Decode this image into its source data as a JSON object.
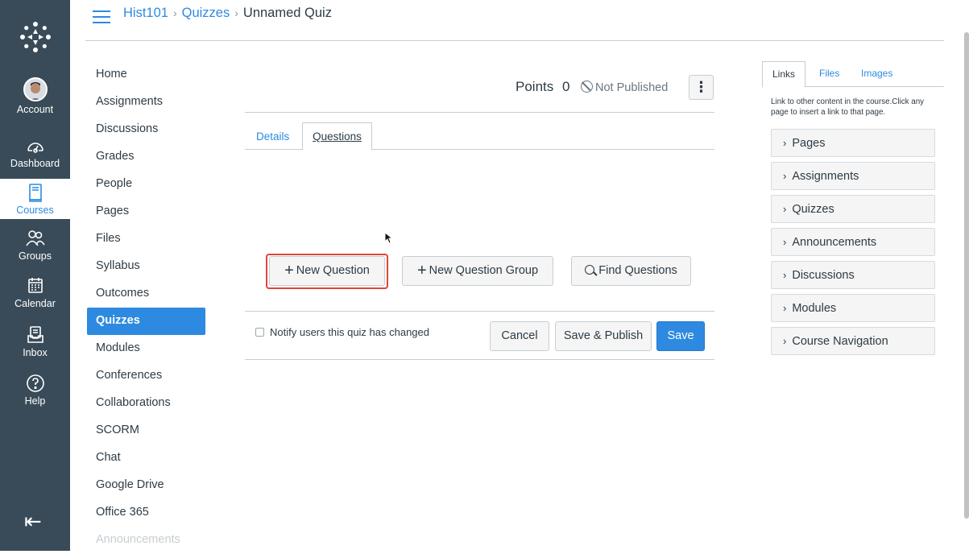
{
  "global_nav": {
    "items": [
      {
        "label": "Account",
        "icon": "avatar"
      },
      {
        "label": "Dashboard",
        "icon": "dashboard-icon"
      },
      {
        "label": "Courses",
        "icon": "courses-icon",
        "active": true
      },
      {
        "label": "Groups",
        "icon": "groups-icon"
      },
      {
        "label": "Calendar",
        "icon": "calendar-icon"
      },
      {
        "label": "Inbox",
        "icon": "inbox-icon"
      },
      {
        "label": "Help",
        "icon": "help-icon"
      }
    ],
    "collapse_glyph": "⇤"
  },
  "breadcrumb": {
    "course": "Hist101",
    "section": "Quizzes",
    "page": "Unnamed Quiz",
    "separator": "›"
  },
  "course_nav": [
    "Home",
    "Assignments",
    "Discussions",
    "Grades",
    "People",
    "Pages",
    "Files",
    "Syllabus",
    "Outcomes",
    "Quizzes",
    "Modules",
    "Conferences",
    "Collaborations",
    "SCORM",
    "Chat",
    "Google Drive",
    "Office 365",
    "Announcements"
  ],
  "course_nav_active": "Quizzes",
  "quiz_header": {
    "points_label": "Points",
    "points_value": "0",
    "status": "Not Published",
    "menu_glyph": "⋮"
  },
  "tabs": {
    "details": "Details",
    "questions": "Questions"
  },
  "actions": {
    "new_question": "New Question",
    "new_question_group": "New Question Group",
    "find_questions": "Find Questions",
    "plus_glyph": "+"
  },
  "footer": {
    "notify_label": "Notify users this quiz has changed",
    "cancel": "Cancel",
    "save_publish": "Save & Publish",
    "save": "Save"
  },
  "right_panel": {
    "tabs": {
      "links": "Links",
      "files": "Files",
      "images": "Images"
    },
    "help_text": "Link to other content in the course.Click any page to insert a link to that page.",
    "items": [
      "Pages",
      "Assignments",
      "Quizzes",
      "Announcements",
      "Discussions",
      "Modules",
      "Course Navigation"
    ],
    "chevron": "›"
  },
  "colors": {
    "nav_bg": "#394b58",
    "link_blue": "#2d8ae0",
    "highlight_red": "#e0453a"
  }
}
